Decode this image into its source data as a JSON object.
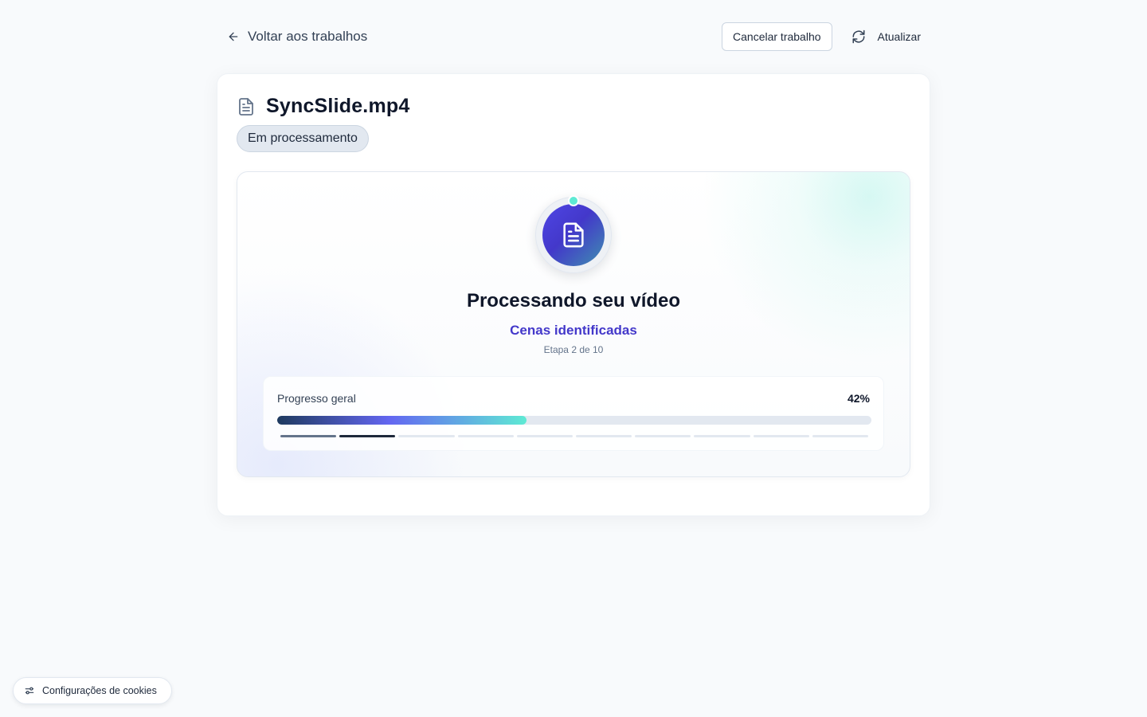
{
  "nav": {
    "back_label": "Voltar aos trabalhos"
  },
  "actions": {
    "cancel_label": "Cancelar trabalho",
    "refresh_label": "Atualizar"
  },
  "job": {
    "file_name": "SyncSlide.mp4",
    "status": "Em processamento",
    "title": "Processando seu vídeo",
    "current_step_label": "Cenas identificadas",
    "step_text": "Etapa 2 de 10",
    "current_step": 2,
    "total_steps": 10
  },
  "progress": {
    "label": "Progresso geral",
    "percent_text": "42%",
    "percent": 42
  },
  "cookies": {
    "label": "Configurações de cookies"
  },
  "icons": {
    "back": "arrow-left-icon",
    "refresh": "refresh-icon",
    "file": "file-text-icon",
    "status_center": "document-icon",
    "cookies": "sliders-icon"
  },
  "colors": {
    "accent": "#4338ca",
    "teal": "#5eead4",
    "progress_start": "#1e3a5f",
    "progress_mid": "#6366f1",
    "progress_end": "#5eead4"
  }
}
